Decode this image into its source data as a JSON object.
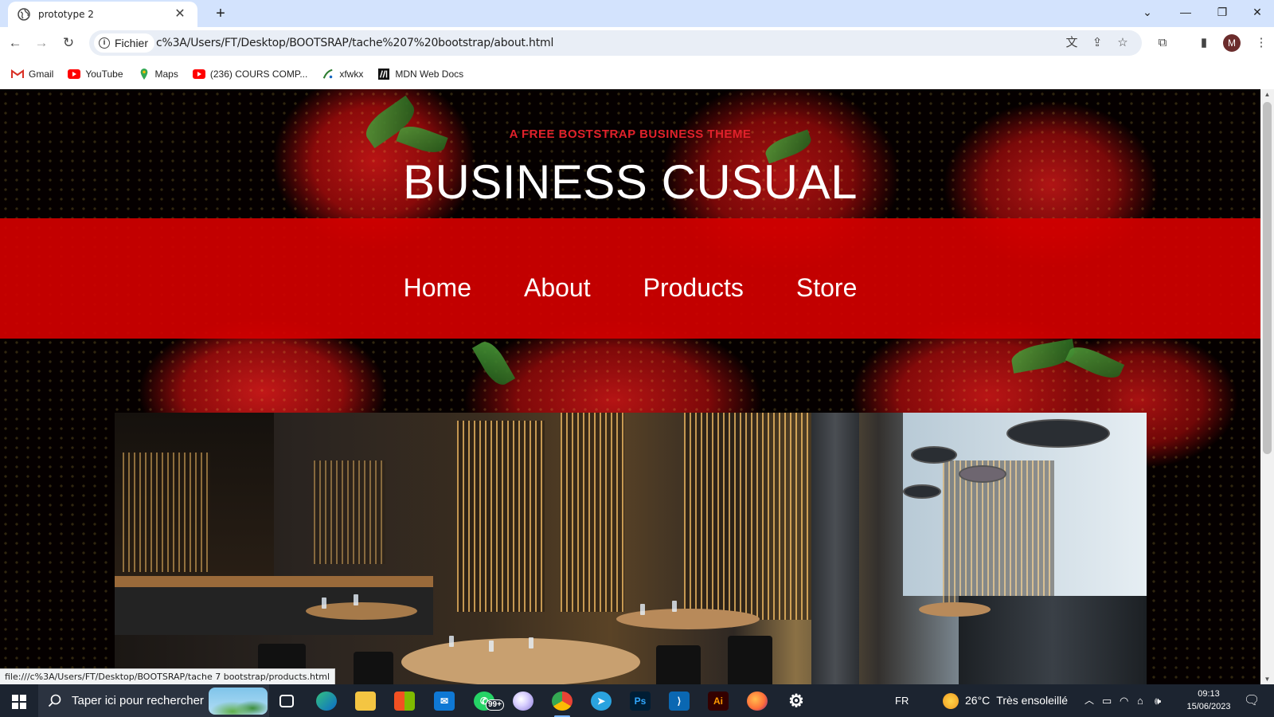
{
  "browser": {
    "tab": {
      "title": "prototype 2"
    },
    "address_chip": "Fichier",
    "url": "c%3A/Users/FT/Desktop/BOOTSRAP/tache%207%20bootstrap/about.html",
    "profile_initial": "M",
    "bookmarks": [
      {
        "label": "Gmail",
        "icon": "gmail-icon"
      },
      {
        "label": "YouTube",
        "icon": "youtube-icon"
      },
      {
        "label": "Maps",
        "icon": "maps-icon"
      },
      {
        "label": "(236) COURS COMP...",
        "icon": "youtube-icon"
      },
      {
        "label": "xfwkx",
        "icon": "xfwkx-icon"
      },
      {
        "label": "MDN Web Docs",
        "icon": "mdn-icon"
      }
    ],
    "status_url": "file:///c%3A/Users/FT/Desktop/BOOTSRAP/tache 7 bootstrap/products.html"
  },
  "page": {
    "tagline": "A FREE BOSTSTRAP BUSINESS THEME",
    "brand": "BUSINESS CUSUAL",
    "nav": [
      "Home",
      "About",
      "Products",
      "Store"
    ],
    "accent_color": "#d20000",
    "tagline_color": "#e0212b"
  },
  "taskbar": {
    "search_placeholder": "Taper ici pour rechercher",
    "whatsapp_badge": "99+",
    "language": "FR",
    "weather_temp": "26°C",
    "weather_text": "Très ensoleillé",
    "time": "09:13",
    "date": "15/06/2023",
    "apps": [
      "task-view-icon",
      "edge-icon",
      "file-explorer-icon",
      "store-icon",
      "mail-icon",
      "whatsapp-icon",
      "paint-icon",
      "chrome-icon",
      "telegram-icon",
      "photoshop-icon",
      "vscode-icon",
      "illustrator-icon",
      "firefox-icon",
      "settings-icon"
    ]
  }
}
